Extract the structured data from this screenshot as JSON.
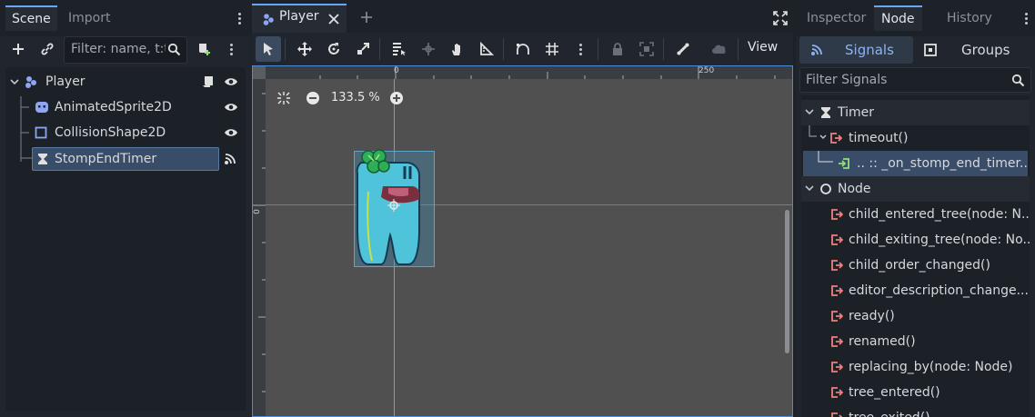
{
  "scene_dock": {
    "tabs": [
      "Scene",
      "Import"
    ],
    "filter_placeholder": "Filter: name, t:t",
    "tree": [
      {
        "label": "Player",
        "icon": "node2d-icon"
      },
      {
        "label": "AnimatedSprite2D",
        "icon": "animated-sprite-icon"
      },
      {
        "label": "CollisionShape2D",
        "icon": "collision-shape-icon"
      },
      {
        "label": "StompEndTimer",
        "icon": "timer-icon"
      }
    ]
  },
  "editor": {
    "tab_label": "Player",
    "view_label": "View",
    "zoom": "133.5 %",
    "ruler_top": [
      "0",
      "250"
    ],
    "ruler_left": [
      "0"
    ]
  },
  "right_dock": {
    "tabs": [
      "Inspector",
      "Node",
      "History"
    ],
    "signals_label": "Signals",
    "groups_label": "Groups",
    "filter_placeholder": "Filter Signals",
    "rows": [
      {
        "kind": "category",
        "label": "Timer"
      },
      {
        "kind": "signal",
        "label": "timeout()"
      },
      {
        "kind": "connection",
        "label": ".. :: _on_stomp_end_timer..."
      },
      {
        "kind": "category",
        "label": "Node"
      },
      {
        "kind": "signal",
        "label": "child_entered_tree(node: N..."
      },
      {
        "kind": "signal",
        "label": "child_exiting_tree(node: No..."
      },
      {
        "kind": "signal",
        "label": "child_order_changed()"
      },
      {
        "kind": "signal",
        "label": "editor_description_change..."
      },
      {
        "kind": "signal",
        "label": "ready()"
      },
      {
        "kind": "signal",
        "label": "renamed()"
      },
      {
        "kind": "signal",
        "label": "replacing_by(node: Node)"
      },
      {
        "kind": "signal",
        "label": "tree_entered()"
      },
      {
        "kind": "signal",
        "label": "tree_exited()"
      }
    ]
  },
  "colors": {
    "accent": "#6aa6f5",
    "signal_icon": "#f08080",
    "connection_icon": "#8ee07a",
    "selection": "#3a4d68"
  }
}
